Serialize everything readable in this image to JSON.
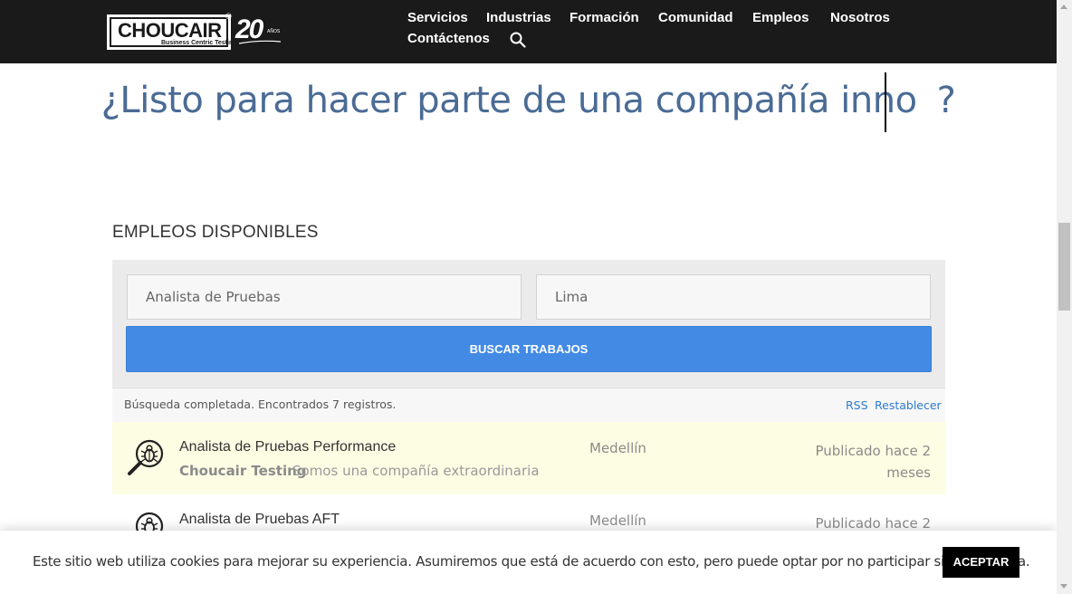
{
  "header": {
    "logo": {
      "wordmark": "CHOUCAIR",
      "registered": "®",
      "tagline": "Business Centric Testing",
      "anniversary": "20",
      "anniversary_small": "AÑOS"
    },
    "nav": [
      {
        "label": "Servicios"
      },
      {
        "label": "Industrias"
      },
      {
        "label": "Formación"
      },
      {
        "label": "Comunidad"
      },
      {
        "label": "Empleos"
      },
      {
        "label": "Nosotros"
      },
      {
        "label": "Contáctenos"
      }
    ],
    "search_icon": "search-icon"
  },
  "hero": {
    "headline_start": "¿Listo para hacer parte de una compañía inno",
    "headline_end": "?"
  },
  "jobs": {
    "section_title": "EMPLEOS DISPONIBLES",
    "keyword_value": "Analista de Pruebas",
    "location_value": "Lima",
    "search_button": "BUSCAR TRABAJOS",
    "result_text": "Búsqueda completada. Encontrados 7 registros.",
    "rss_label": "RSS",
    "reset_label": "Restablecer",
    "items": [
      {
        "title": "Analista de Pruebas Performance",
        "company": "Choucair Testing",
        "tagline": "Somos una compañía extraordinaria",
        "location": "Medellín",
        "date": "Publicado hace 2 meses",
        "icon": "bug-magnifier-icon",
        "highlighted": true
      },
      {
        "title": "Analista de Pruebas AFT",
        "company": "",
        "tagline": "",
        "location": "Medellín",
        "date": "Publicado hace 2",
        "icon": "bug-magnifier-icon",
        "highlighted": false
      }
    ]
  },
  "cookie": {
    "text": "Este sitio web utiliza cookies para mejorar su experiencia. Asumiremos que está de acuerdo con esto, pero puede optar por no participar si así lo desea.",
    "accept_label": "ACEPTAR"
  },
  "colors": {
    "topbar": "#1a1a1a",
    "headline": "#4a6b95",
    "button": "#438ae5",
    "highlight_row": "#fdfde4",
    "link": "#2e7bcf"
  }
}
